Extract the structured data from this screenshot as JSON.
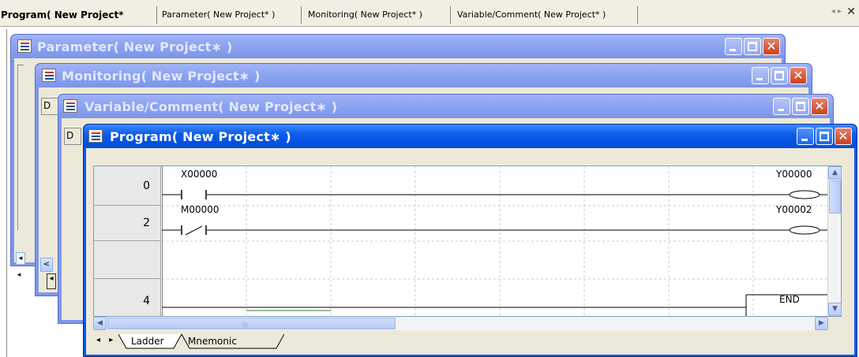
{
  "tabbar": {
    "tabs": [
      {
        "label": "Program( New Project*",
        "active": true
      },
      {
        "label": "Parameter( New Project* )",
        "active": false
      },
      {
        "label": "Monitoring( New Project* )",
        "active": false
      },
      {
        "label": "Variable/Comment( New Project* )",
        "active": false
      }
    ],
    "nav_arrows": "◂ ▸",
    "close_glyph": "✕"
  },
  "windows": {
    "parameter": {
      "title": "Parameter( New Project∗ )"
    },
    "monitoring": {
      "title": "Monitoring( New Project∗ )"
    },
    "variable": {
      "title": "Variable/Comment( New Project∗ )",
      "peek_text": "D"
    },
    "program": {
      "title": "Program( New Project∗ )"
    }
  },
  "ladder": {
    "steps": [
      "0",
      "2",
      "",
      "4"
    ],
    "rungs": [
      {
        "contact_label": "X00000",
        "contact_type": "normally-open",
        "coil_label": "Y00000"
      },
      {
        "contact_label": "M00000",
        "contact_type": "normally-closed",
        "coil_label": "Y00002"
      }
    ],
    "end_label": "END"
  },
  "sheet_tabs": [
    "Ladder",
    "Mnemonic"
  ],
  "colors": {
    "active_title": "#0a58e6",
    "inactive_title": "#7d97ea",
    "grid_line": "#c0c0c0"
  }
}
